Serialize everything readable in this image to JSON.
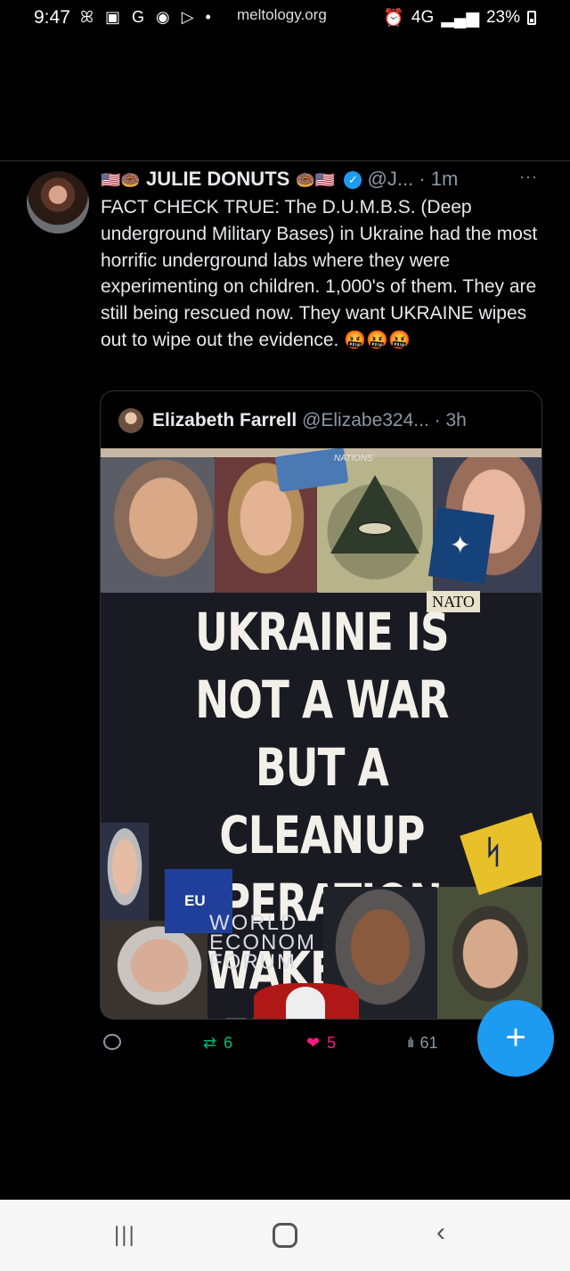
{
  "status_bar": {
    "time": "9:47",
    "notif_icons": "ꕤ ▣ G ◉ ▷ •",
    "url": "meltology.org",
    "network": "4G",
    "battery": "23%"
  },
  "tweet": {
    "flag_emoji_left": "🇺🇸🍩",
    "author_name": "JULIE DONUTS",
    "flag_emoji_right": "🍩🇺🇸",
    "verified": "✓",
    "handle": "@J...",
    "time": "· 1m",
    "more": "···",
    "text": "FACT CHECK TRUE: The D.U.M.B.S. (Deep underground Military Bases) in Ukraine had the most horrific underground labs where they were experimenting on children. 1,000's of them. They are still being rescued now. They want UKRAINE wipes out to wipe out the evidence.",
    "text_emojis": "🤬🤬🤬"
  },
  "quote": {
    "author_name": "Elizabeth Farrell",
    "handle": "@Elizabe324...",
    "time": "· 3h",
    "image": {
      "headline": "UKRAINE IS NOT A WAR BUT A CLEANUP OPERATION. WAKE THE FUCK UP.",
      "un_text": "NATIONS",
      "nato_label": "NATO",
      "eu_label": "EU",
      "wef_label": "WORLD ECONOM FORUM"
    }
  },
  "actions": {
    "retweets": "6",
    "likes": "5",
    "views": "61"
  },
  "fab": {
    "label": "+"
  },
  "nav": {
    "recents": "|||",
    "back": "‹"
  },
  "colors": {
    "accent": "#1d9bf0",
    "retweet": "#00ba7c",
    "like": "#f91880",
    "muted": "#8b98a5"
  }
}
